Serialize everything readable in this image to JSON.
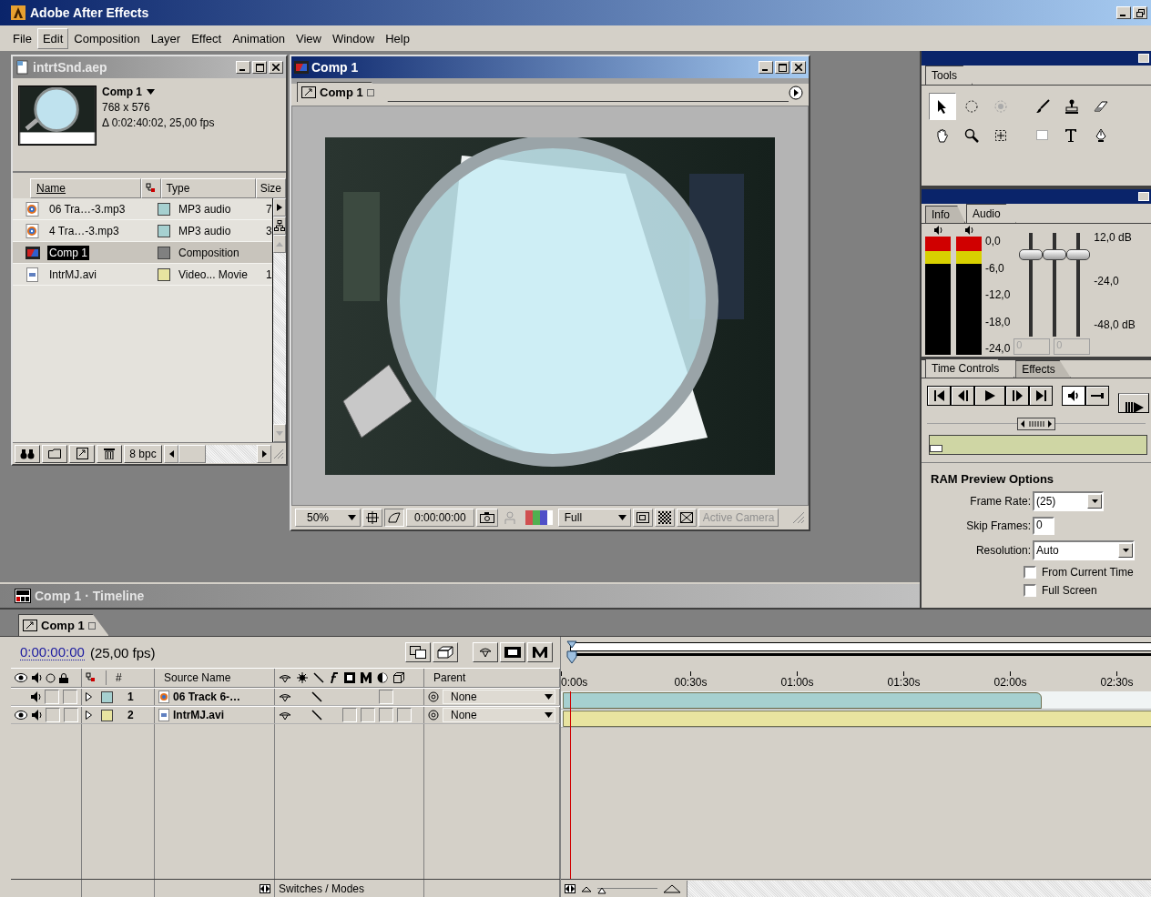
{
  "app": {
    "title": "Adobe After Effects"
  },
  "menu": [
    {
      "label": "File",
      "selected": false
    },
    {
      "label": "Edit",
      "selected": true
    },
    {
      "label": "Composition",
      "selected": false
    },
    {
      "label": "Layer",
      "selected": false
    },
    {
      "label": "Effect",
      "selected": false
    },
    {
      "label": "Animation",
      "selected": false
    },
    {
      "label": "View",
      "selected": false
    },
    {
      "label": "Window",
      "selected": false
    },
    {
      "label": "Help",
      "selected": false
    }
  ],
  "project": {
    "title": "intrtSnd.aep",
    "preview": {
      "name": "Comp 1",
      "size": "768 x 576",
      "duration": "Δ 0:02:40:02, 25,00 fps"
    },
    "columns": {
      "name": "Name",
      "type": "Type",
      "size": "Size"
    },
    "items": [
      {
        "name": "06 Tra…-3.mp3",
        "kind": "audio",
        "color": "#a6d0d0",
        "type": "MP3 audio",
        "size": "7",
        "selected": false
      },
      {
        "name": "4 Tra…-3.mp3",
        "kind": "audio",
        "color": "#a6d0d0",
        "type": "MP3 audio",
        "size": "3",
        "selected": false
      },
      {
        "name": "Comp 1",
        "kind": "comp",
        "color": "#808080",
        "type": "Composition",
        "selected": true
      },
      {
        "name": "IntrMJ.avi",
        "kind": "video",
        "color": "#e8e4a0",
        "type": "Video... Movie",
        "size": "1",
        "selected": false
      }
    ],
    "depth": "8 bpc"
  },
  "comp": {
    "title": "Comp 1",
    "tab": "Comp 1",
    "zoom": "50%",
    "timecode": "0:00:00:00",
    "resolution": "Full",
    "camera": "Active Camera"
  },
  "tools": {
    "tab": "Tools",
    "items": [
      {
        "kind": "selection",
        "selected": true
      },
      {
        "kind": "rotation",
        "selected": false
      },
      {
        "kind": "orbit",
        "selected": false
      },
      {
        "kind": "brush",
        "selected": false
      },
      {
        "kind": "stamp",
        "selected": false
      },
      {
        "kind": "eraser",
        "selected": false
      },
      {
        "kind": "hand",
        "selected": false
      },
      {
        "kind": "zoom",
        "selected": false
      },
      {
        "kind": "pan",
        "selected": false
      },
      {
        "kind": "rectangle",
        "selected": false
      },
      {
        "kind": "text",
        "selected": false
      },
      {
        "kind": "pen",
        "selected": false
      }
    ]
  },
  "audio": {
    "tabs": [
      {
        "label": "Info",
        "selected": false
      },
      {
        "label": "Audio",
        "selected": true
      }
    ],
    "meters": [
      {
        "level": 0.23
      },
      {
        "level": 0.23
      }
    ],
    "meter_scale": [
      "0,0",
      "-6,0",
      "-12,0",
      "-18,0",
      "-24,0"
    ],
    "faders": [
      {
        "level": 0.82
      },
      {
        "level": 0.82
      },
      {
        "level": 0.82
      }
    ],
    "fader_scale": [
      "12,0 dB",
      "-24,0",
      "-48,0 dB"
    ],
    "fields": [
      "0",
      "0"
    ]
  },
  "time_controls": {
    "tabs": [
      {
        "label": "Time Controls",
        "selected": true
      },
      {
        "label": "Effects",
        "selected": false
      }
    ],
    "ram_preview": {
      "title": "RAM Preview Options",
      "frame_rate": {
        "label": "Frame Rate:",
        "value": "(25)"
      },
      "skip_frames": {
        "label": "Skip Frames:",
        "value": "0"
      },
      "resolution": {
        "label": "Resolution:",
        "value": "Auto"
      },
      "options": [
        {
          "label": "From Current Time",
          "checked": false
        },
        {
          "label": "Full Screen",
          "checked": false
        }
      ]
    }
  },
  "timeline": {
    "title": "Comp 1 · Timeline",
    "tab": "Comp 1",
    "timecode": "0:00:00:00",
    "fps": "(25,00 fps)",
    "columns": {
      "number": "#",
      "source": "Source Name",
      "parent": "Parent"
    },
    "ruler": [
      "0:00s",
      "00:30s",
      "01:00s",
      "01:30s",
      "02:00s",
      "02:30s"
    ],
    "layers": [
      {
        "number": "1",
        "name": "06 Track 6-…",
        "kind": "audio",
        "color": "#a6d0d0",
        "video": false,
        "audio": true,
        "solo": false,
        "locked": false,
        "parent": "None",
        "level": 0.8
      },
      {
        "number": "2",
        "name": "IntrMJ.avi",
        "kind": "video",
        "color": "#e8e4a0",
        "video": true,
        "audio": true,
        "solo": false,
        "locked": false,
        "parent": "None",
        "level": 1
      }
    ],
    "zoom": {
      "level": 0
    },
    "footer": "Switches / Modes"
  }
}
